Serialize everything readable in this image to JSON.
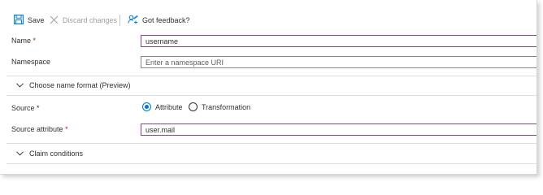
{
  "toolbar": {
    "save_label": "Save",
    "discard_label": "Discard changes",
    "feedback_label": "Got feedback?"
  },
  "form": {
    "name": {
      "label": "Name",
      "required_mark": "*",
      "value": "username"
    },
    "namespace": {
      "label": "Namespace",
      "value": "",
      "placeholder": "Enter a namespace URI"
    },
    "name_format_section": {
      "label": "Choose name format (Preview)",
      "expanded": false
    },
    "source": {
      "label": "Source",
      "required_mark": "*",
      "options": [
        "Attribute",
        "Transformation"
      ],
      "selected": "Attribute"
    },
    "source_attribute": {
      "label": "Source attribute",
      "required_mark": "*",
      "value": "user.mail"
    },
    "claim_conditions_section": {
      "label": "Claim conditions",
      "expanded": false
    }
  },
  "colors": {
    "accent": "#0078d4",
    "active_border": "#8d3f97",
    "required": "#a4262c"
  }
}
